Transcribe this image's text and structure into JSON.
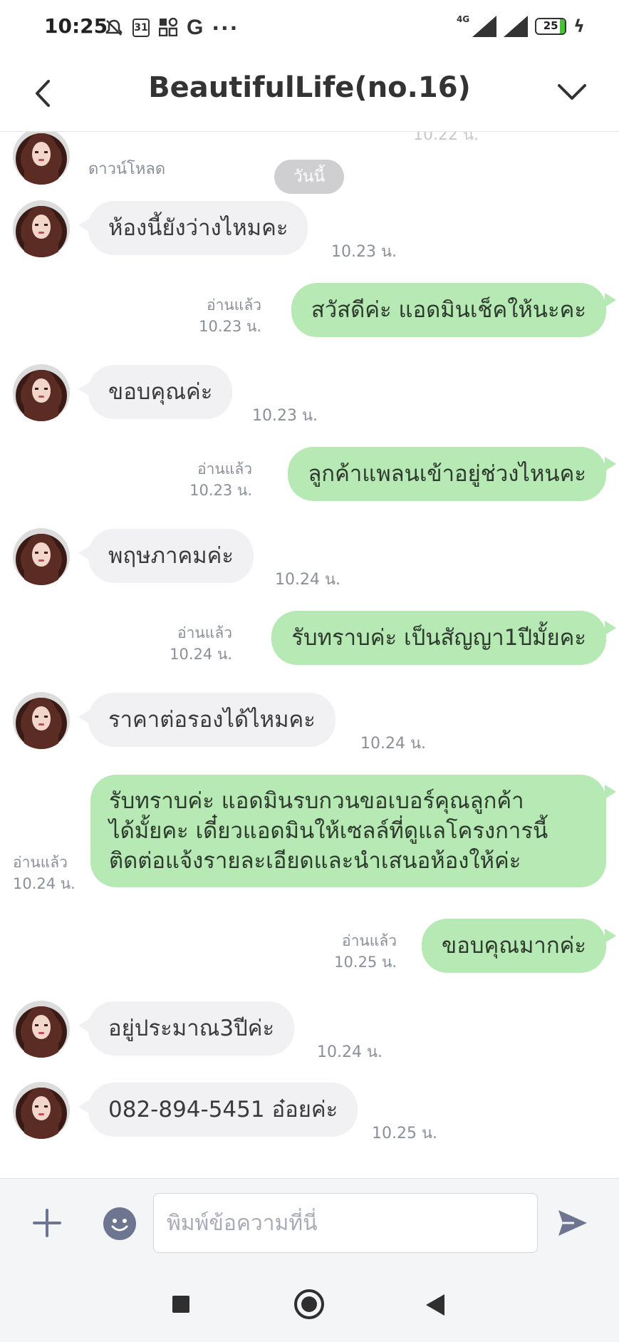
{
  "status_bar": {
    "time": "10:25",
    "icons": [
      "mute-icon",
      "calendar-icon",
      "apps-grid-icon",
      "google-icon",
      "more-dots-icon"
    ],
    "calendar_day": "31",
    "google_letter": "G",
    "dots": "···",
    "network": "4G",
    "battery_level": "25",
    "charging": true
  },
  "header": {
    "title": "BeautifulLife(no.16)"
  },
  "chat": {
    "ghost_time": "10.22 น.",
    "download_label": "ดาวน์โหลด",
    "date_chip": "วันนี้",
    "messages": [
      {
        "dir": "in",
        "text": "ห้องนี้ยังว่างไหมคะ",
        "time": "10.23 น."
      },
      {
        "dir": "out",
        "text": "สวัสดีค่ะ แอดมินเช็คให้นะคะ",
        "read": "อ่านแล้ว",
        "time": "10.23 น."
      },
      {
        "dir": "in",
        "text": "ขอบคุณค่ะ",
        "time": "10.23 น."
      },
      {
        "dir": "out",
        "text": "ลูกค้าแพลนเข้าอยู่ช่วงไหนคะ",
        "read": "อ่านแล้ว",
        "time": "10.23 น."
      },
      {
        "dir": "in",
        "text": "พฤษภาคมค่ะ",
        "time": "10.24 น."
      },
      {
        "dir": "out",
        "text": "รับทราบค่ะ เป็นสัญญา1ปีมั้ยคะ",
        "read": "อ่านแล้ว",
        "time": "10.24 น."
      },
      {
        "dir": "in",
        "text": "ราคาต่อรองได้ไหมคะ",
        "time": "10.24 น."
      },
      {
        "dir": "out",
        "lines": [
          "รับทราบค่ะ แอดมินรบกวนขอเบอร์คุณลูกค้า",
          "ได้มั้ยคะ เดี๋ยวแอดมินให้เซลล์ที่ดูแลโครงการนี้",
          "ติดต่อแจ้งรายละเอียดและนำเสนอห้องให้ค่ะ"
        ],
        "read": "อ่านแล้ว",
        "time": "10.24 น."
      },
      {
        "dir": "out",
        "text": "ขอบคุณมากค่ะ",
        "read": "อ่านแล้ว",
        "time": "10.25 น."
      },
      {
        "dir": "in",
        "text": "อยู่ประมาณ3ปีค่ะ",
        "time": "10.24 น."
      },
      {
        "dir": "in",
        "text": "082-894-5451 อ๋อยค่ะ",
        "time": "10.25 น."
      }
    ]
  },
  "input_bar": {
    "placeholder": "พิมพ์ข้อความที่นี่",
    "value": ""
  },
  "colors": {
    "outgoing_bubble": "#b6e9b3",
    "incoming_bubble": "#f1f1f3",
    "meta_text": "#8a8f99",
    "send_icon": "#6e7590"
  }
}
